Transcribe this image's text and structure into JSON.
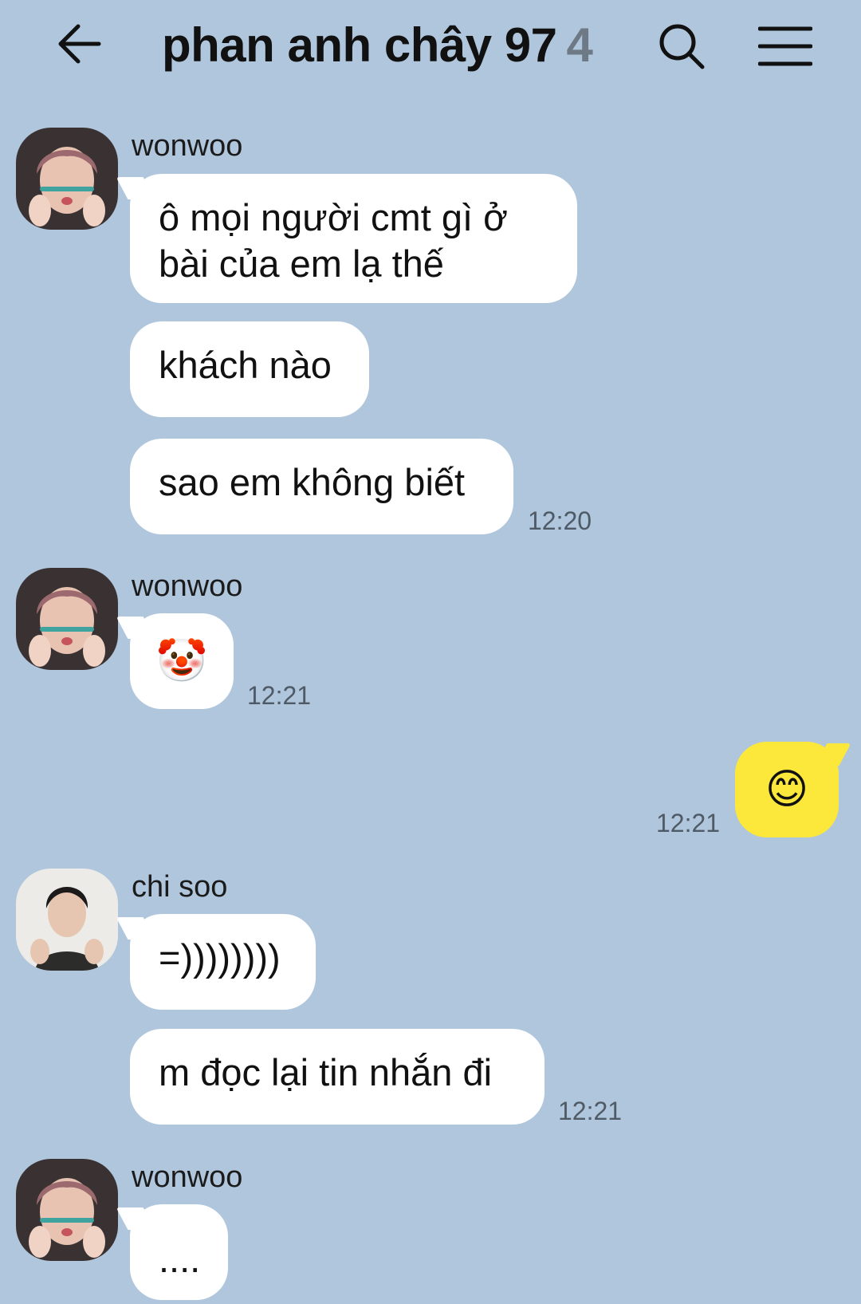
{
  "header": {
    "title": "phan anh chây 97",
    "member_count": "4",
    "back_icon": "arrow-left-icon",
    "search_icon": "search-icon",
    "menu_icon": "hamburger-menu-icon"
  },
  "colors": {
    "background": "#b0c6dc",
    "bubble_other": "#ffffff",
    "bubble_mine": "#fbe83a"
  },
  "messages": [
    {
      "sender": "wonwoo",
      "bubbles": [
        "ô mọi người cmt gì ở bài của em lạ thế",
        "khách nào",
        "sao em không biết"
      ],
      "time": "12:20"
    },
    {
      "sender": "wonwoo",
      "bubbles": [
        "🤡"
      ],
      "time": "12:21"
    },
    {
      "sender": "me",
      "bubbles": [
        "😊"
      ],
      "time": "12:21"
    },
    {
      "sender": "chi soo",
      "bubbles": [
        "=))))))))",
        "m đọc lại tin nhắn đi"
      ],
      "time": "12:21"
    },
    {
      "sender": "wonwoo",
      "bubbles": [
        "...."
      ],
      "time": ""
    }
  ]
}
